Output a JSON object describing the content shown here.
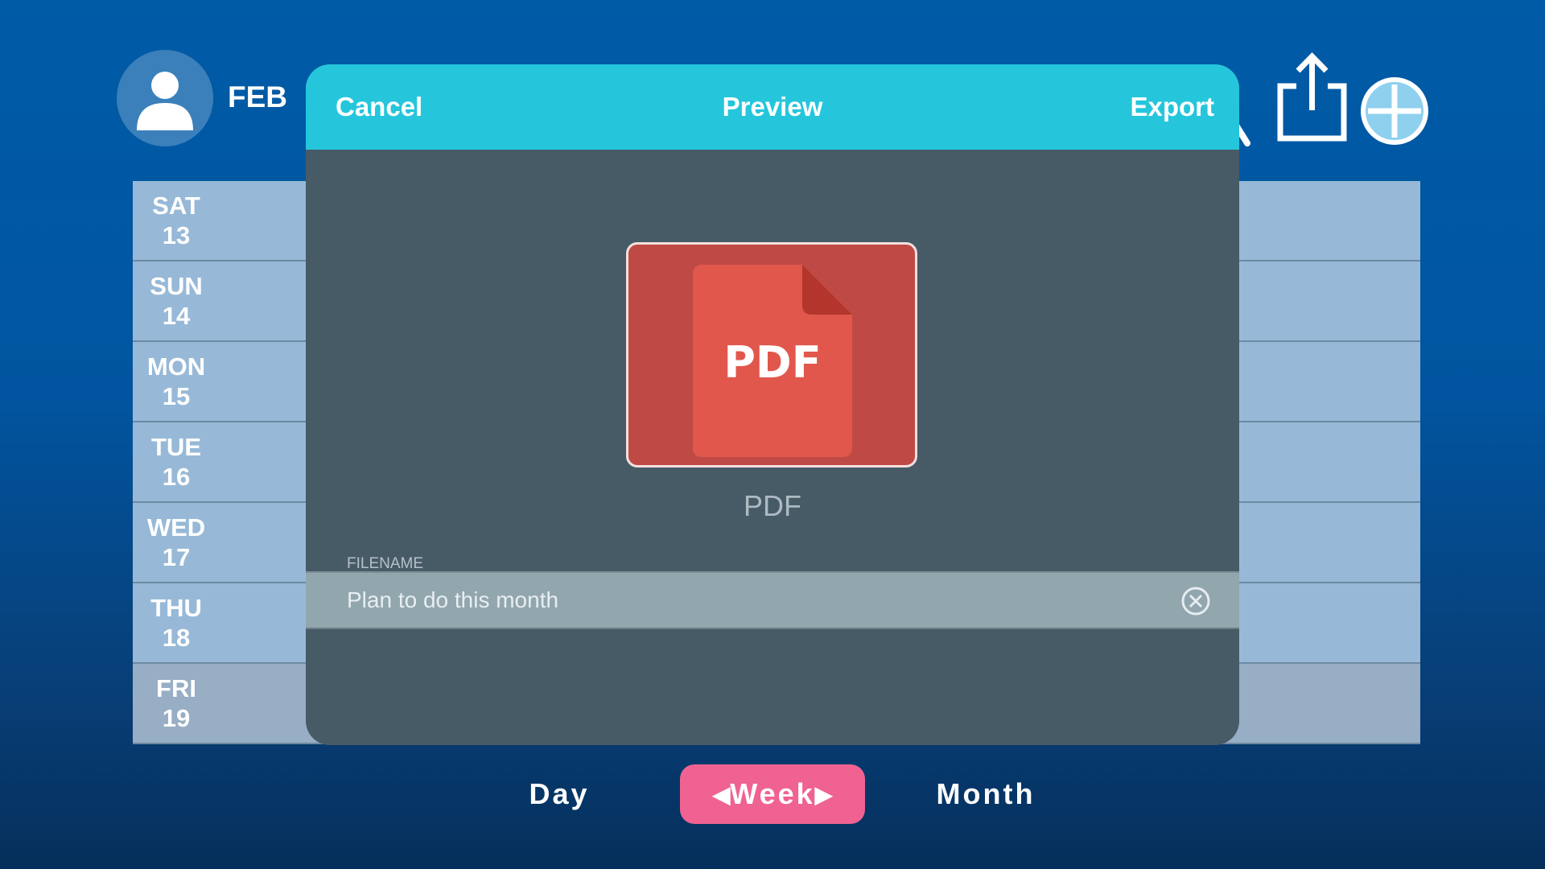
{
  "header": {
    "month": "FEB",
    "icons": [
      "user-avatar-icon",
      "search-icon",
      "share-icon",
      "add-icon"
    ]
  },
  "calendar": {
    "days": [
      {
        "weekday": "SAT",
        "date": "13"
      },
      {
        "weekday": "SUN",
        "date": "14"
      },
      {
        "weekday": "MON",
        "date": "15"
      },
      {
        "weekday": "TUE",
        "date": "16"
      },
      {
        "weekday": "WED",
        "date": "17"
      },
      {
        "weekday": "THU",
        "date": "18"
      },
      {
        "weekday": "FRI",
        "date": "19"
      }
    ]
  },
  "tabs": {
    "day": "Day",
    "week": "Week",
    "month": "Month",
    "active": "week"
  },
  "modal": {
    "cancel_label": "Cancel",
    "title": "Preview",
    "export_label": "Export",
    "file_type_badge": "PDF",
    "file_type_caption": "PDF",
    "filename_label": "FILENAME",
    "filename_value": "Plan to do this month"
  },
  "colors": {
    "background": "#005ba6",
    "modal_header": "#25c6dc",
    "modal_body": "#475b67",
    "active_tab": "#ef6291",
    "pdf_tile": "#bf4a45"
  }
}
